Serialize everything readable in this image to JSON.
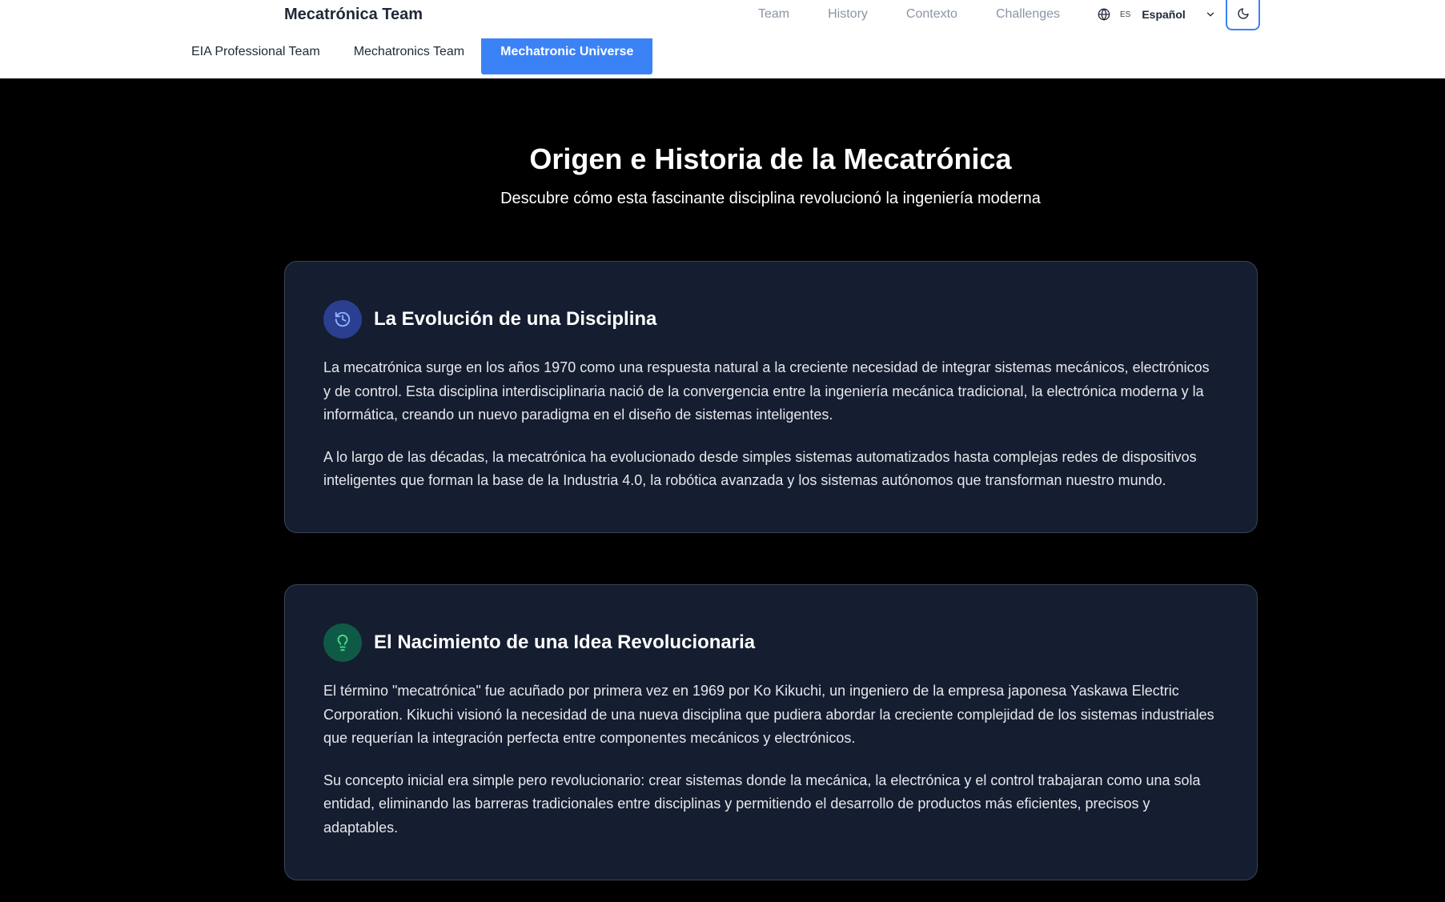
{
  "header": {
    "brand": "Mecatrónica Team",
    "nav": [
      "Team",
      "History",
      "Contexto",
      "Challenges"
    ],
    "language": {
      "code": "ES",
      "name": "Español"
    }
  },
  "subnav": {
    "tabs": [
      "EIA Professional Team",
      "Mechatronics Team",
      "Mechatronic Universe"
    ],
    "active": "Mechatronic Universe"
  },
  "hero": {
    "title": "Origen e Historia de la Mecatrónica",
    "subtitle": "Descubre cómo esta fascinante disciplina revolucionó la ingeniería moderna"
  },
  "cards": [
    {
      "icon": "history-icon",
      "icon_bg": "#2b3f91",
      "icon_color": "#93b4ff",
      "title": "La Evolución de una Disciplina",
      "paragraphs": [
        "La mecatrónica surge en los años 1970 como una respuesta natural a la creciente necesidad de integrar sistemas mecánicos, electrónicos y de control. Esta disciplina interdisciplinaria nació de la convergencia entre la ingeniería mecánica tradicional, la electrónica moderna y la informática, creando un nuevo paradigma en el diseño de sistemas inteligentes.",
        "A lo largo de las décadas, la mecatrónica ha evolucionado desde simples sistemas automatizados hasta complejas redes de dispositivos inteligentes que forman la base de la Industria 4.0, la robótica avanzada y los sistemas autónomos que transforman nuestro mundo."
      ]
    },
    {
      "icon": "lightbulb-icon",
      "icon_bg": "#0f5a46",
      "icon_color": "#4ade80",
      "title": "El Nacimiento de una Idea Revolucionaria",
      "paragraphs": [
        "El término \"mecatrónica\" fue acuñado por primera vez en 1969 por Ko Kikuchi, un ingeniero de la empresa japonesa Yaskawa Electric Corporation. Kikuchi visionó la necesidad de una nueva disciplina que pudiera abordar la creciente complejidad de los sistemas industriales que requerían la integración perfecta entre componentes mecánicos y electrónicos.",
        "Su concepto inicial era simple pero revolucionario: crear sistemas donde la mecánica, la electrónica y el control trabajaran como una sola entidad, eliminando las barreras tradicionales entre disciplinas y permitiendo el desarrollo de productos más eficientes, precisos y adaptables."
      ]
    }
  ],
  "colors": {
    "accent": "#3b82f6",
    "page_bg": "#000000",
    "card_bg": "#151d30"
  }
}
